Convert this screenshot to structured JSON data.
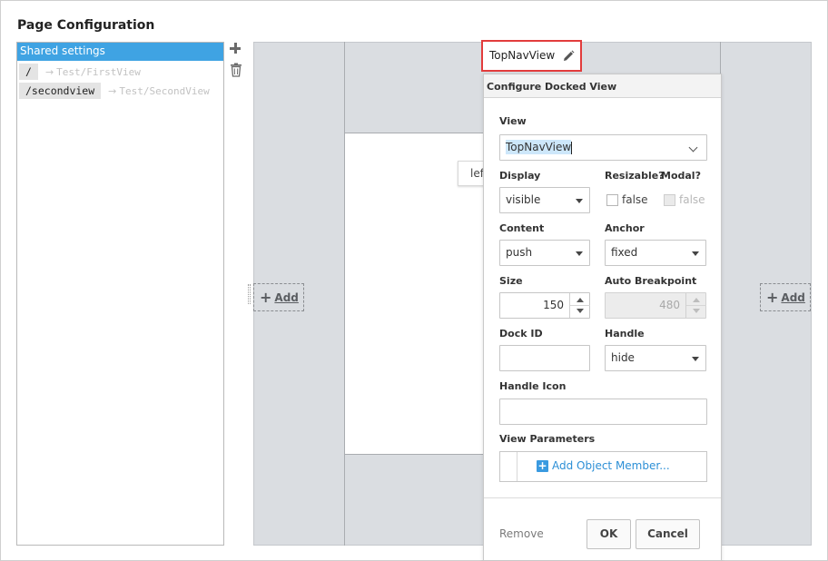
{
  "page_title": "Page Configuration",
  "page_list": {
    "shared_label": "Shared settings",
    "routes": [
      {
        "path": "/",
        "arrow": "→",
        "view": "Test/FirstView"
      },
      {
        "path": "/secondview",
        "arrow": "→",
        "view": "Test/SecondView"
      }
    ]
  },
  "canvas": {
    "left_chip": "lef",
    "add_plus": "+",
    "add_label": "Add",
    "top_view_name": "TopNavView"
  },
  "panel": {
    "title": "Configure Docked View",
    "view_label": "View",
    "view_value": "TopNavView",
    "display_label": "Display",
    "display_value": "visible",
    "resizable_label": "Resizable?",
    "resizable_value": "false",
    "modal_label": "Modal?",
    "modal_value": "false",
    "content_label": "Content",
    "content_value": "push",
    "anchor_label": "Anchor",
    "anchor_value": "fixed",
    "size_label": "Size",
    "size_value": "150",
    "auto_breakpoint_label": "Auto Breakpoint",
    "auto_breakpoint_value": "480",
    "dock_id_label": "Dock ID",
    "dock_id_value": "",
    "handle_label": "Handle",
    "handle_value": "hide",
    "handle_icon_label": "Handle Icon",
    "handle_icon_value": "",
    "view_params_label": "View Parameters",
    "add_member_plus": "+",
    "add_member_label": "Add Object Member...",
    "remove_label": "Remove",
    "ok_label": "OK",
    "cancel_label": "Cancel"
  },
  "colors": {
    "accent": "#3fa3e3",
    "highlight_border": "#e23c3c",
    "canvas_bg": "#dadde1",
    "link": "#2c8fd6"
  },
  "icons": [
    "add-page-icon",
    "delete-page-icon",
    "pencil-icon",
    "chevron-down-icon",
    "spinner-icon",
    "plus-icon"
  ]
}
